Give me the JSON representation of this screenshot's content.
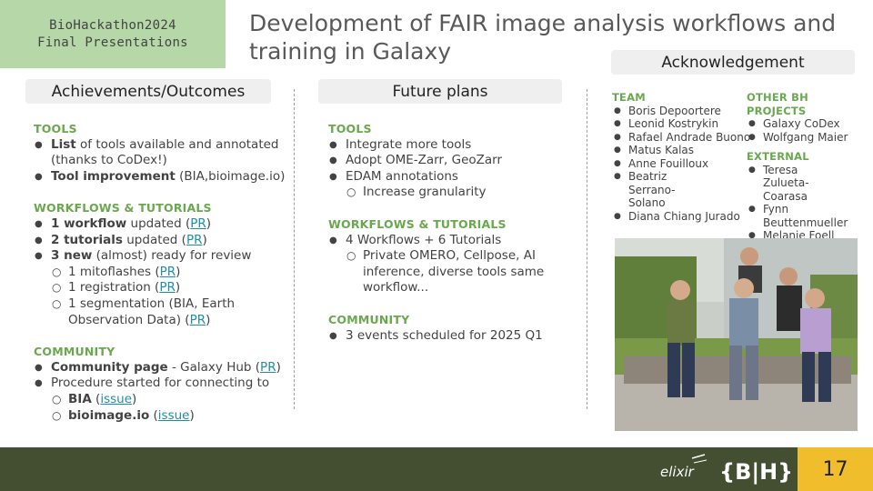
{
  "event": {
    "line1": "BioHackathon2024",
    "line2": "Final Presentations"
  },
  "title": "Development of FAIR image analysis workflows and training in Galaxy",
  "achievements": {
    "header": "Achievements/Outcomes",
    "tools_title": "TOOLS",
    "tools_1_bold": "List",
    "tools_1_rest": " of tools available and annotated (thanks to CoDex!)",
    "tools_2_bold": "Tool improvement",
    "tools_2_rest": " (BIA,bioimage.io)",
    "wf_title": "WORKFLOWS & TUTORIALS",
    "wf_1_bold": "1 workflow",
    "wf_1_rest": " updated (",
    "wf_2_bold": "2 tutorials",
    "wf_2_rest": " updated (",
    "wf_3_bold": "3 new",
    "wf_3_rest": " (almost) ready for review",
    "wf_sub_1": "1 mitoflashes (",
    "wf_sub_2": "1 registration (",
    "wf_sub_3": "1 segmentation (BIA, Earth Observation Data) (",
    "pr": "PR",
    "close": ")",
    "comm_title": "COMMUNITY",
    "comm_1_bold": "Community page",
    "comm_1_rest": " - Galaxy Hub (",
    "comm_2": "Procedure started for connecting to",
    "comm_sub_1_bold": "BIA",
    "comm_sub_2_bold": "bioimage.io",
    "open": " (",
    "issue": "issue"
  },
  "future": {
    "header": "Future plans",
    "tools_title": "TOOLS",
    "tools_items": [
      "Integrate more tools",
      "Adopt OME-Zarr, GeoZarr",
      "EDAM annotations"
    ],
    "tools_sub": "Increase granularity",
    "wf_title": "WORKFLOWS & TUTORIALS",
    "wf_item": "4 Workflows + 6 Tutorials",
    "wf_sub": "Private OMERO, Cellpose, AI inference, diverse tools same workflow...",
    "comm_title": "COMMUNITY",
    "comm_item": "3 events scheduled for 2025 Q1"
  },
  "acknowledgement": {
    "header": "Acknowledgement",
    "team_title": "TEAM",
    "team": [
      "Boris Depoortere",
      "Leonid Kostrykin",
      "Rafael Andrade Buono",
      "Matus Kalas",
      "Anne Fouilloux",
      "Beatriz Serrano-Solano",
      "Diana Chiang Jurado"
    ],
    "other_title": "OTHER BH PROJECTS",
    "other": [
      "Galaxy CoDex",
      "Wolfgang Maier"
    ],
    "external_title": "EXTERNAL",
    "external": [
      "Teresa Zulueta-Coarasa",
      "Fynn Beuttenmueller",
      "Melanie Foell"
    ]
  },
  "footer": {
    "page_number": "17",
    "logo_1": "elixir",
    "logo_2": "{B|H}"
  },
  "colors": {
    "accent_green": "#6aa84f",
    "event_box": "#b6d7a8",
    "footer": "#434f30",
    "page_box": "#f0bd2c",
    "link": "#1f8fa8"
  }
}
